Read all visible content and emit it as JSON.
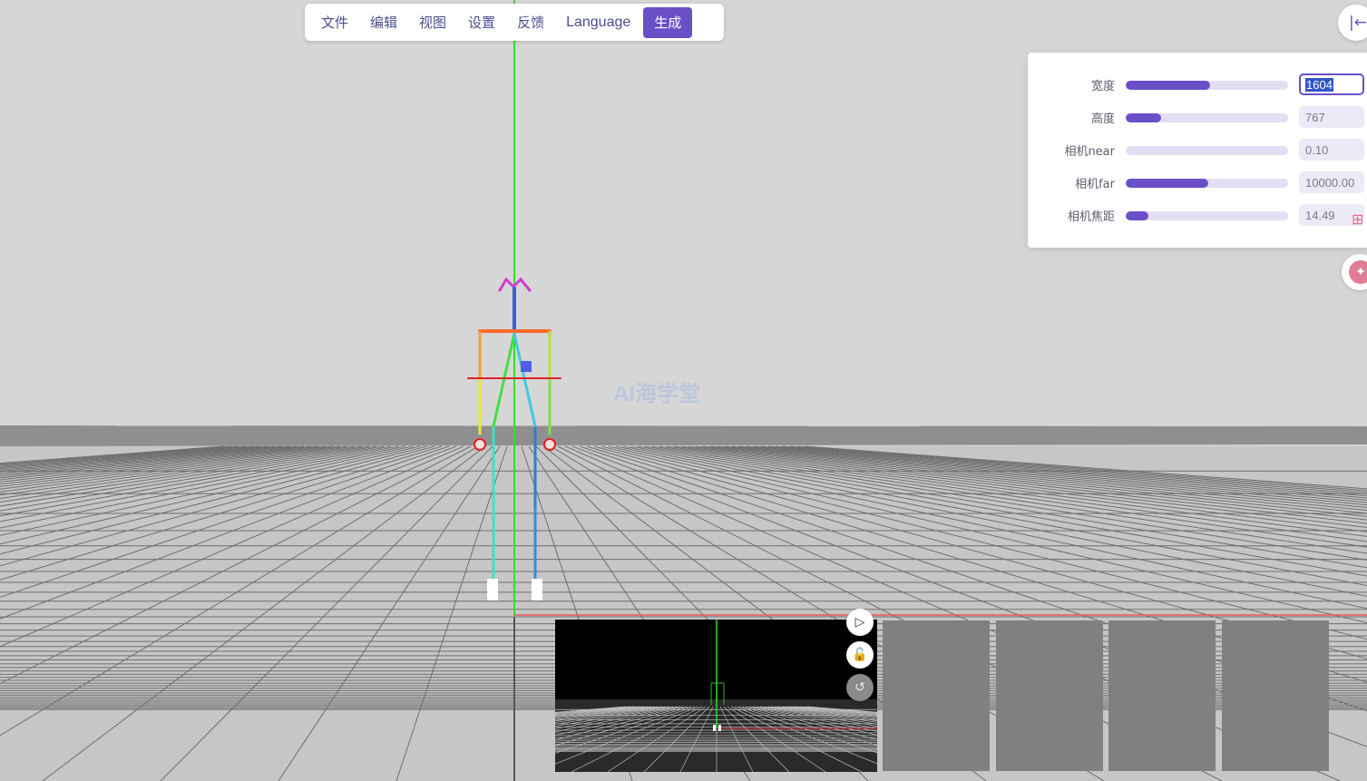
{
  "menu": {
    "items": [
      "文件",
      "编辑",
      "视图",
      "设置",
      "反馈",
      "Language"
    ],
    "primary": "生成"
  },
  "panel": {
    "rows": [
      {
        "label": "宽度",
        "value": "1604",
        "fill": 0.52,
        "focused": true
      },
      {
        "label": "高度",
        "value": "767",
        "fill": 0.22
      },
      {
        "label": "相机near",
        "value": "0.10",
        "fill": 0.0
      },
      {
        "label": "相机far",
        "value": "10000.00",
        "fill": 0.51
      },
      {
        "label": "相机焦距",
        "value": "14.49",
        "fill": 0.14
      }
    ]
  },
  "icons": {
    "collapse": "collapse-panel-icon",
    "play": "play-icon",
    "lock": "unlock-icon",
    "undo": "undo-icon",
    "grid": "grid-icon"
  },
  "watermark": "AI海学堂",
  "colors": {
    "accent": "#6a4fc9",
    "sky": "#d6d6d6",
    "floor": "#c9c9c9",
    "axis_y": "#22dd22",
    "axis_x": "#ee4444"
  }
}
